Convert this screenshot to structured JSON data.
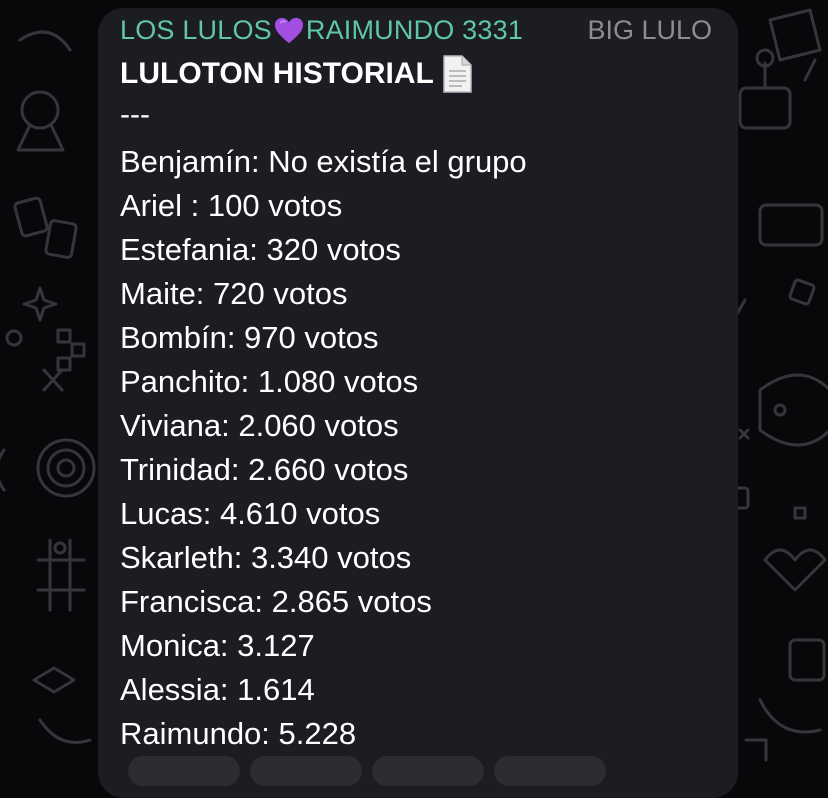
{
  "message": {
    "sender_before": "LOS LULOS",
    "sender_after": "RAIMUNDO 3331",
    "badge": "BIG LULO",
    "title": "LULOTON HISTORIAL",
    "separator": "---",
    "lines": [
      "Benjamín: No existía el grupo",
      "Ariel : 100 votos",
      "Estefania: 320 votos",
      "Maite: 720 votos",
      "Bombín: 970 votos",
      "Panchito: 1.080 votos",
      "Viviana: 2.060 votos",
      "Trinidad: 2.660 votos",
      "Lucas: 4.610 votos",
      "Skarleth: 3.340 votos",
      "Francisca: 2.865 votos",
      "Monica: 3.127",
      "Alessia: 1.614",
      "Raimundo: 5.228"
    ]
  },
  "colors": {
    "sender": "#5fc6a9",
    "heart": "#a24ee0",
    "bubble": "#1c1d22",
    "background": "#07080a",
    "badge": "#8b8d93"
  },
  "icons": {
    "sender_separator": "purple-heart-icon",
    "title_suffix": "page-document-icon"
  }
}
